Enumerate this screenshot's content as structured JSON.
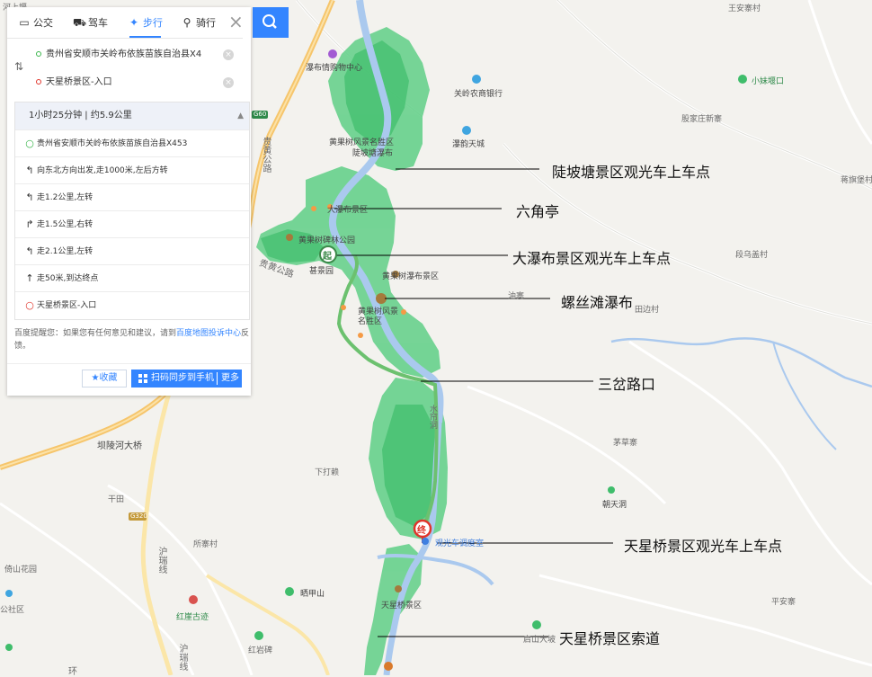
{
  "modes": [
    {
      "label": "公交",
      "icon": "bus-icon"
    },
    {
      "label": "驾车",
      "icon": "car-icon"
    },
    {
      "label": "步行",
      "icon": "walk-icon",
      "active": true
    },
    {
      "label": "骑行",
      "icon": "bike-icon"
    }
  ],
  "inputs": {
    "start": "贵州省安顺市关岭布依族苗族自治县X4",
    "end": "天星桥景区-入口"
  },
  "route": {
    "summary": "1小时25分钟 | 约5.9公里",
    "steps": [
      {
        "icon": "start-dot-icon",
        "text": "贵州省安顺市关岭布依族苗族自治县X453"
      },
      {
        "icon": "turn-left-icon",
        "text": "向东北方向出发,走1000米,左后方转"
      },
      {
        "icon": "turn-left-icon",
        "text": "走1.2公里,左转"
      },
      {
        "icon": "turn-right-icon",
        "text": "走1.5公里,右转"
      },
      {
        "icon": "turn-left-icon",
        "text": "走2.1公里,左转"
      },
      {
        "icon": "straight-icon",
        "text": "走50米,到达终点"
      },
      {
        "icon": "end-dot-icon",
        "text": "天星桥景区-入口"
      }
    ]
  },
  "notice": {
    "prefix": "百度提醒您：如果您有任何意见和建议，请到",
    "link": "百度地图投诉中心",
    "suffix": "反馈。"
  },
  "buttons": {
    "favorite": "收藏",
    "sync": "扫码同步到手机",
    "more": "更多"
  },
  "map_labels": {
    "river_top": "河上堰",
    "wang_an": "王安寨村",
    "shopping": "瀑布情购物中心",
    "bank": "关岭农商银行",
    "xiaomei": "小妹堰口",
    "guo_ren": "股家庄新寨",
    "huangguoshu_hall": "黄果树风景名胜区",
    "doupotang": "陡坡塘瀑布",
    "pubu_tiancheng": "瀑韵天城",
    "jiangjiabao": "蒋旗堡村",
    "dapubu_area": "大瀑布景区",
    "huangguoshu_park": "黄果树碑林公园",
    "road_gui_huang": "贵黄公路",
    "road_gui_huang_2": "贵黄公路",
    "g60": "G60",
    "duan_wu": "段乌盖村",
    "pubu_area": "黄果树瀑布景区",
    "zhenjing": "甚景园",
    "you_zhai": "油寨",
    "huangguoshu_scenic": "黄果树风景名胜区",
    "bei_cun": "田边村",
    "baling_bridge": "坝陵河大桥",
    "shuiliandong": "水帘洞",
    "maozhai": "茅草寨",
    "xiadazhai": "下打赖",
    "ganxi": "干田",
    "g320": "G320",
    "chaotiandong": "朝天洞",
    "guanguang": "观光车调度室",
    "suo_zhai": "所寨村",
    "hu_rui_1": "沪瑞线",
    "hu_rui_2": "沪瑞线",
    "qiaoshan_park": "倚山花园",
    "gongqu": "公社区",
    "hongya": "红崖古迹",
    "saijiashan": "晒甲山",
    "tianxingqiao_area": "天星桥景区",
    "pingan": "平安寨",
    "hongyanbei": "红岩碑",
    "qishan": "启山大坡",
    "huan": "环"
  },
  "annotations": [
    "陡坡塘景区观光车上车点",
    "六角亭",
    "大瀑布景区观光车上车点",
    "螺丝滩瀑布",
    "三岔路口",
    "天星桥景区观光车上车点",
    "天星桥景区索道"
  ],
  "markers": {
    "start": "起",
    "end": "终"
  },
  "colors": {
    "accent": "#3385ff",
    "route": "#6cc16f",
    "scenic": "#5fcf86",
    "water": "#aac9ee"
  }
}
